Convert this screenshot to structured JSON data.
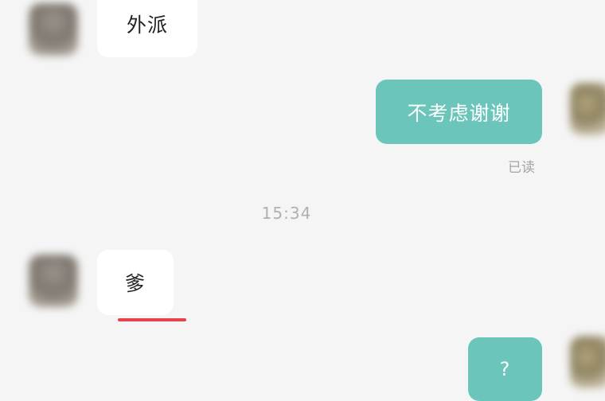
{
  "messages": [
    {
      "side": "incoming",
      "text": "外派"
    },
    {
      "side": "outgoing",
      "text": "不考虑谢谢",
      "status": "已读"
    },
    {
      "side": "incoming",
      "text": "爹"
    },
    {
      "side": "outgoing",
      "text": "?"
    }
  ],
  "timestamp": "15:34",
  "colors": {
    "outgoing_bubble": "#6bc5bb",
    "incoming_bubble": "#ffffff",
    "background": "#f5f5f5",
    "underline": "#e8424d"
  }
}
